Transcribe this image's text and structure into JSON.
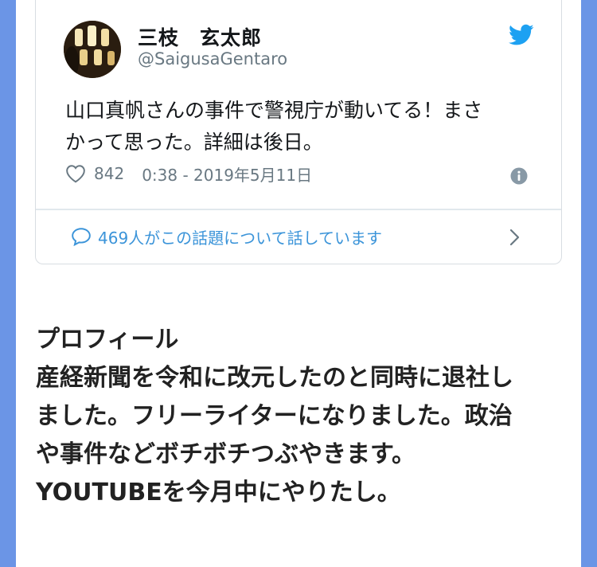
{
  "tweet": {
    "author_name": "三枝　玄太郎",
    "author_handle": "@SaigusaGentaro",
    "text_lines": [
      "山口真帆さんの事件で警視庁が動いてる！まさ",
      "かって思った。詳細は後日。"
    ],
    "like_count": "842",
    "timestamp": "0:38 - 2019年5月11日",
    "conversation_text": "469人がこの話題について話しています",
    "icons": {
      "brand": "twitter-bird-icon",
      "like": "heart-icon",
      "info": "info-icon",
      "conversation": "speech-bubble-icon",
      "more": "chevron-right-icon"
    },
    "colors": {
      "twitter_blue": "#1da1f2",
      "link_blue": "#3b94d9",
      "muted": "#697882"
    }
  },
  "profile": {
    "lines": [
      "プロフィール",
      "産経新聞を令和に改元したのと同時に退社し",
      "ました。フリーライターになりました。政治",
      "や事件などボチボチつぶやきます。",
      "YOUTUBEを今月中にやりたし。"
    ]
  },
  "colors": {
    "side_background": "#6b95e6"
  }
}
